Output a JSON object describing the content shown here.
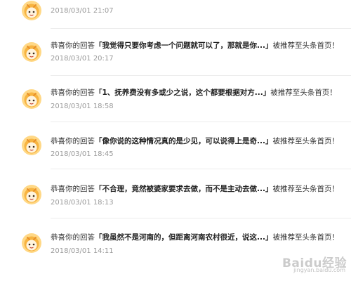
{
  "items": [
    {
      "prefix": "",
      "quote": "",
      "suffix": "",
      "time": "2018/03/01 21:07"
    },
    {
      "prefix": "恭喜你的回答",
      "quote": "「我觉得只要你考虑一个问题就可以了，那就是你...」",
      "suffix": "被推荐至头条首页！",
      "time": "2018/03/01 20:17"
    },
    {
      "prefix": "恭喜你的回答",
      "quote": "「1、抚养费没有多或少之说，这个都要根据对方...」",
      "suffix": "被推荐至头条首页！",
      "time": "2018/03/01 18:58"
    },
    {
      "prefix": "恭喜你的回答",
      "quote": "「像你说的这种情况真的是少见，可以说得上是奇...」",
      "suffix": "被推荐至头条首页！",
      "time": "2018/03/01 18:45"
    },
    {
      "prefix": "恭喜你的回答",
      "quote": "「不合理，竟然被婆家要求去做，而不是主动去做...」",
      "suffix": "被推荐至头条首页！",
      "time": "2018/03/01 18:13"
    },
    {
      "prefix": "恭喜你的回答",
      "quote": "「我虽然不是河南的，但距离河南农村很近，说这...」",
      "suffix": "被推荐至头条首页！",
      "time": "2018/03/01 14:11"
    }
  ],
  "watermark": {
    "logo": "Baidu经验",
    "url": "jingyan.baidu.com"
  },
  "colors": {
    "avatar_face": "#f7b441",
    "avatar_ring": "#ffd886",
    "time": "#9a9a9a",
    "divider": "#ececec"
  },
  "icons": {
    "avatar": "smiley-bot-avatar-icon"
  }
}
